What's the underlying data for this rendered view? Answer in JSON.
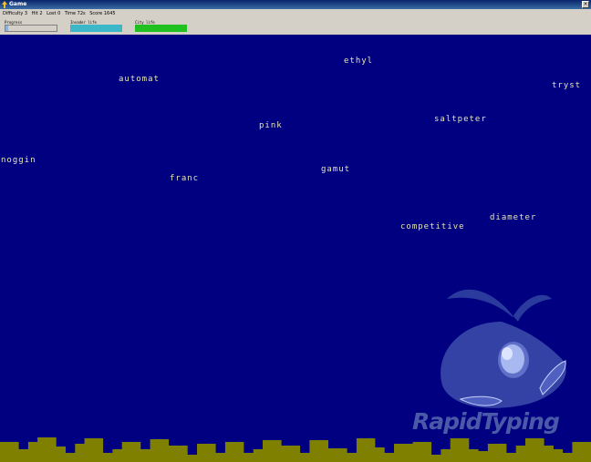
{
  "window": {
    "title": "Game",
    "close_glyph": "×"
  },
  "stats": {
    "difficulty": "Difficulty 3",
    "hit": "Hit 2",
    "lost": "Lost 0",
    "time": "Time 72s",
    "score": "Score 1645"
  },
  "bars": {
    "progress_label": "Progress",
    "invader_label": "Invader life",
    "city_label": "City life",
    "progress_value": 0.05,
    "invader_value": 1.0,
    "city_value": 1.0
  },
  "words": [
    {
      "text": "ethyl"
    },
    {
      "text": "automat"
    },
    {
      "text": "tryst"
    },
    {
      "text": "saltpeter"
    },
    {
      "text": "pink"
    },
    {
      "text": "noggin"
    },
    {
      "text": "gamut"
    },
    {
      "text": "franc"
    },
    {
      "text": "diameter"
    },
    {
      "text": "competitive"
    }
  ],
  "logo": {
    "text": "RapidTyping"
  },
  "colors": {
    "playfield": "#000080",
    "word_text": "#e6e6b4",
    "city": "#808000",
    "invader_life": "#3cb7c7",
    "city_life": "#20c020"
  },
  "icons": {
    "title": "app-icon",
    "close": "close-icon",
    "mascot": "whale-mascot"
  }
}
